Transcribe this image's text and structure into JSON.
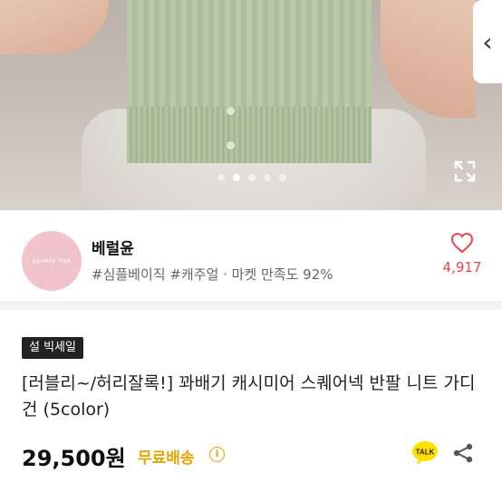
{
  "hero": {
    "carousel": {
      "dot_count": 5,
      "active_index": 1
    },
    "back_icon": "chevron-left-icon",
    "expand_icon": "expand-icon"
  },
  "seller": {
    "avatar_text": "Lovely Yun",
    "name": "베럴윤",
    "tags": "#심플베이직 #캐주얼 · 마켓 만족도 92%",
    "like_icon": "heart-icon",
    "like_count": "4,917"
  },
  "product": {
    "badge": "설 빅세일",
    "title": "[러블리~/허리잘록!] 꽈배기 캐시미어 스퀘어넥 반팔 니트 가디건 (5color)",
    "price": "29,500원",
    "shipping": "무료배송",
    "talk_label": "TALK",
    "share_icon": "share-icon"
  },
  "colors": {
    "accent_red": "#e9444f",
    "shipping_yellow": "#e9a400",
    "badge_bg": "#222222"
  }
}
